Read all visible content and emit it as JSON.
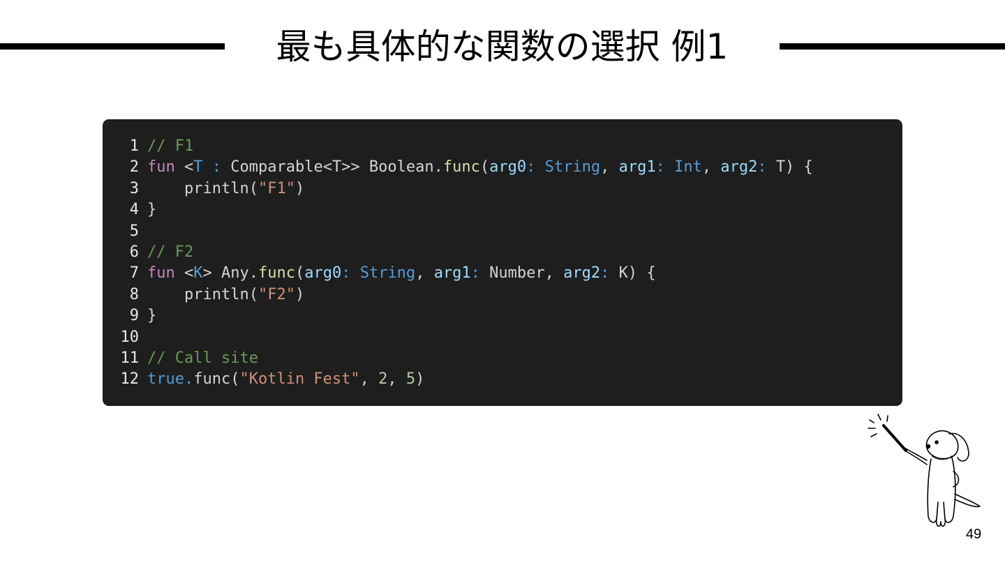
{
  "slide": {
    "title": "最も具体的な関数の選択 例1",
    "page_number": "49"
  },
  "code": {
    "lines": [
      {
        "number": "1",
        "tokens": [
          {
            "t": "// F1",
            "k": "comment"
          }
        ]
      },
      {
        "number": "2",
        "tokens": [
          {
            "t": "fun",
            "k": "keyword"
          },
          {
            "t": " <",
            "k": "plain"
          },
          {
            "t": "T",
            "k": "type"
          },
          {
            "t": " ",
            "k": "plain"
          },
          {
            "t": ":",
            "k": "type"
          },
          {
            "t": " Comparable<T>> Boolean.",
            "k": "plain"
          },
          {
            "t": "func",
            "k": "func"
          },
          {
            "t": "(",
            "k": "plain"
          },
          {
            "t": "arg0",
            "k": "param"
          },
          {
            "t": ": ",
            "k": "type"
          },
          {
            "t": "String",
            "k": "type"
          },
          {
            "t": ", ",
            "k": "plain"
          },
          {
            "t": "arg1",
            "k": "param"
          },
          {
            "t": ": ",
            "k": "type"
          },
          {
            "t": "Int",
            "k": "type"
          },
          {
            "t": ", ",
            "k": "plain"
          },
          {
            "t": "arg2",
            "k": "param"
          },
          {
            "t": ": ",
            "k": "type"
          },
          {
            "t": "T) {",
            "k": "plain"
          }
        ]
      },
      {
        "number": "3",
        "tokens": [
          {
            "t": "    println(",
            "k": "plain"
          },
          {
            "t": "\"F1\"",
            "k": "string"
          },
          {
            "t": ")",
            "k": "plain"
          }
        ]
      },
      {
        "number": "4",
        "tokens": [
          {
            "t": "}",
            "k": "plain"
          }
        ]
      },
      {
        "number": "5",
        "tokens": []
      },
      {
        "number": "6",
        "tokens": [
          {
            "t": "// F2",
            "k": "comment"
          }
        ]
      },
      {
        "number": "7",
        "tokens": [
          {
            "t": "fun",
            "k": "keyword"
          },
          {
            "t": " <",
            "k": "plain"
          },
          {
            "t": "K",
            "k": "type"
          },
          {
            "t": "> Any.",
            "k": "plain"
          },
          {
            "t": "func",
            "k": "func"
          },
          {
            "t": "(",
            "k": "plain"
          },
          {
            "t": "arg0",
            "k": "param"
          },
          {
            "t": ": ",
            "k": "type"
          },
          {
            "t": "String",
            "k": "type"
          },
          {
            "t": ", ",
            "k": "plain"
          },
          {
            "t": "arg1",
            "k": "param"
          },
          {
            "t": ": ",
            "k": "type"
          },
          {
            "t": "Number, ",
            "k": "plain"
          },
          {
            "t": "arg2",
            "k": "param"
          },
          {
            "t": ": ",
            "k": "type"
          },
          {
            "t": "K) {",
            "k": "plain"
          }
        ]
      },
      {
        "number": "8",
        "tokens": [
          {
            "t": "    println(",
            "k": "plain"
          },
          {
            "t": "\"F2\"",
            "k": "string"
          },
          {
            "t": ")",
            "k": "plain"
          }
        ]
      },
      {
        "number": "9",
        "tokens": [
          {
            "t": "}",
            "k": "plain"
          }
        ]
      },
      {
        "number": "10",
        "tokens": []
      },
      {
        "number": "11",
        "tokens": [
          {
            "t": "// Call site",
            "k": "comment"
          }
        ]
      },
      {
        "number": "12",
        "tokens": [
          {
            "t": "true",
            "k": "type"
          },
          {
            "t": ".",
            "k": "type"
          },
          {
            "t": "func(",
            "k": "plain"
          },
          {
            "t": "\"Kotlin Fest\"",
            "k": "string"
          },
          {
            "t": ", ",
            "k": "plain"
          },
          {
            "t": "2",
            "k": "number"
          },
          {
            "t": ", ",
            "k": "plain"
          },
          {
            "t": "5",
            "k": "number"
          },
          {
            "t": ")",
            "k": "plain"
          }
        ]
      }
    ]
  },
  "colors": {
    "panel_background": "#1e1e1e",
    "comment": "#6a9955",
    "keyword": "#c586c0",
    "type": "#569cd6",
    "function": "#dcdcaa",
    "parameter": "#9cdcfe",
    "string": "#ce9178",
    "number": "#b5cea8",
    "plain": "#d4d4d4"
  },
  "mascot": {
    "icon": "dog-pointing-icon"
  }
}
